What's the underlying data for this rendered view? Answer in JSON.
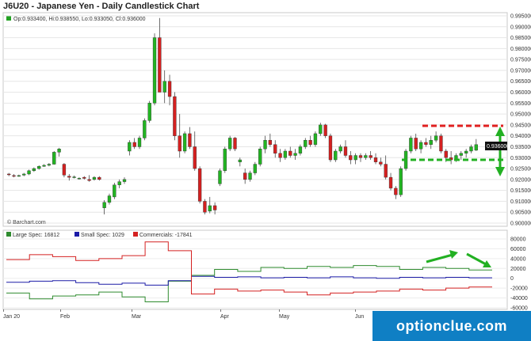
{
  "chart_title": "J6U20 - Japanese Yen - Daily Candlestick Chart",
  "ohlc_legend": "Op:0.933400, Hi:0.938550, Lo:0.933050, Cl:0.936000",
  "last_price": "0.936000",
  "watermark": "© Barchart.com",
  "cot_legend": [
    {
      "label": "Large Spec: 16812",
      "color": "#2e8b2e"
    },
    {
      "label": "Small Spec: 1029",
      "color": "#1a1aa6"
    },
    {
      "label": "Commercials: -17841",
      "color": "#d42020"
    }
  ],
  "brand": "optionclue.com",
  "chart_data": {
    "type": "candlestick",
    "title": "J6U20 - Japanese Yen - Daily Candlestick Chart",
    "price_axis": {
      "ylim": [
        0.9,
        0.995
      ],
      "ticks": [
        "0.995000",
        "0.990000",
        "0.985000",
        "0.980000",
        "0.975000",
        "0.970000",
        "0.965000",
        "0.960000",
        "0.955000",
        "0.950000",
        "0.945000",
        "0.940000",
        "0.935000",
        "0.930000",
        "0.925000",
        "0.920000",
        "0.915000",
        "0.910000",
        "0.905000",
        "0.900000"
      ]
    },
    "x_axis": {
      "month_labels": [
        "Jan 20",
        "Feb",
        "Mar",
        "Apr",
        "May",
        "Jun"
      ]
    },
    "candles": [
      [
        0.9225,
        0.923,
        0.9215,
        0.9222
      ],
      [
        0.9218,
        0.9225,
        0.921,
        0.9215
      ],
      [
        0.9215,
        0.9222,
        0.9212,
        0.9218
      ],
      [
        0.922,
        0.923,
        0.9215,
        0.9225
      ],
      [
        0.9225,
        0.9245,
        0.922,
        0.924
      ],
      [
        0.924,
        0.9255,
        0.9235,
        0.925
      ],
      [
        0.925,
        0.9265,
        0.9245,
        0.926
      ],
      [
        0.926,
        0.927,
        0.9258,
        0.9265
      ],
      [
        0.9265,
        0.9275,
        0.926,
        0.927
      ],
      [
        0.927,
        0.933,
        0.9268,
        0.9325
      ],
      [
        0.9325,
        0.9345,
        0.9305,
        0.934
      ],
      [
        0.927,
        0.9275,
        0.921,
        0.922
      ],
      [
        0.9215,
        0.9225,
        0.9195,
        0.921
      ],
      [
        0.921,
        0.9218,
        0.9205,
        0.9212
      ],
      [
        0.9205,
        0.921,
        0.92,
        0.9206
      ],
      [
        0.921,
        0.9215,
        0.92,
        0.9205
      ],
      [
        0.92,
        0.922,
        0.919,
        0.9195
      ],
      [
        0.92,
        0.9215,
        0.9195,
        0.921
      ],
      [
        0.921,
        0.9215,
        0.9195,
        0.92
      ],
      [
        0.907,
        0.9105,
        0.904,
        0.9095
      ],
      [
        0.9095,
        0.9135,
        0.9085,
        0.9125
      ],
      [
        0.912,
        0.9185,
        0.911,
        0.9175
      ],
      [
        0.9175,
        0.92,
        0.916,
        0.919
      ],
      [
        0.919,
        0.921,
        0.918,
        0.92
      ],
      [
        0.933,
        0.938,
        0.931,
        0.937
      ],
      [
        0.937,
        0.939,
        0.934,
        0.935
      ],
      [
        0.935,
        0.94,
        0.934,
        0.939
      ],
      [
        0.939,
        0.948,
        0.938,
        0.947
      ],
      [
        0.947,
        0.956,
        0.946,
        0.955
      ],
      [
        0.955,
        0.987,
        0.954,
        0.985
      ],
      [
        0.985,
        0.994,
        0.962,
        0.96
      ],
      [
        0.96,
        0.97,
        0.955,
        0.965
      ],
      [
        0.965,
        0.968,
        0.954,
        0.958
      ],
      [
        0.958,
        0.96,
        0.938,
        0.94
      ],
      [
        0.94,
        0.95,
        0.93,
        0.933
      ],
      [
        0.933,
        0.942,
        0.932,
        0.941
      ],
      [
        0.941,
        0.944,
        0.934,
        0.935
      ],
      [
        0.935,
        0.942,
        0.924,
        0.925
      ],
      [
        0.925,
        0.926,
        0.909,
        0.91
      ],
      [
        0.91,
        0.911,
        0.904,
        0.905
      ],
      [
        0.9055,
        0.912,
        0.9045,
        0.908
      ],
      [
        0.908,
        0.9095,
        0.904,
        0.906
      ],
      [
        0.918,
        0.925,
        0.917,
        0.924
      ],
      [
        0.924,
        0.935,
        0.923,
        0.934
      ],
      [
        0.934,
        0.94,
        0.933,
        0.939
      ],
      [
        0.939,
        0.9395,
        0.933,
        0.934
      ],
      [
        0.928,
        0.93,
        0.926,
        0.929
      ],
      [
        0.923,
        0.925,
        0.918,
        0.92
      ],
      [
        0.92,
        0.924,
        0.919,
        0.923
      ],
      [
        0.923,
        0.928,
        0.922,
        0.927
      ],
      [
        0.927,
        0.935,
        0.926,
        0.934
      ],
      [
        0.934,
        0.94,
        0.932,
        0.938
      ],
      [
        0.938,
        0.941,
        0.935,
        0.936
      ],
      [
        0.936,
        0.938,
        0.93,
        0.932
      ],
      [
        0.932,
        0.934,
        0.928,
        0.93
      ],
      [
        0.93,
        0.934,
        0.929,
        0.933
      ],
      [
        0.933,
        0.935,
        0.93,
        0.931
      ],
      [
        0.931,
        0.934,
        0.929,
        0.932
      ],
      [
        0.932,
        0.936,
        0.931,
        0.935
      ],
      [
        0.935,
        0.939,
        0.934,
        0.938
      ],
      [
        0.938,
        0.94,
        0.935,
        0.936
      ],
      [
        0.936,
        0.942,
        0.935,
        0.941
      ],
      [
        0.941,
        0.946,
        0.94,
        0.945
      ],
      [
        0.945,
        0.9455,
        0.939,
        0.94
      ],
      [
        0.94,
        0.941,
        0.928,
        0.929
      ],
      [
        0.929,
        0.934,
        0.928,
        0.933
      ],
      [
        0.933,
        0.936,
        0.932,
        0.935
      ],
      [
        0.935,
        0.938,
        0.93,
        0.931
      ],
      [
        0.931,
        0.933,
        0.927,
        0.929
      ],
      [
        0.929,
        0.932,
        0.927,
        0.931
      ],
      [
        0.931,
        0.932,
        0.928,
        0.93
      ],
      [
        0.93,
        0.932,
        0.929,
        0.931
      ],
      [
        0.931,
        0.933,
        0.929,
        0.93
      ],
      [
        0.93,
        0.932,
        0.927,
        0.928
      ],
      [
        0.928,
        0.93,
        0.926,
        0.927
      ],
      [
        0.927,
        0.931,
        0.92,
        0.921
      ],
      [
        0.921,
        0.923,
        0.915,
        0.916
      ],
      [
        0.916,
        0.917,
        0.911,
        0.913
      ],
      [
        0.913,
        0.926,
        0.912,
        0.925
      ],
      [
        0.925,
        0.934,
        0.924,
        0.933
      ],
      [
        0.933,
        0.94,
        0.932,
        0.939
      ],
      [
        0.939,
        0.941,
        0.933,
        0.934
      ],
      [
        0.934,
        0.938,
        0.932,
        0.937
      ],
      [
        0.937,
        0.939,
        0.935,
        0.936
      ],
      [
        0.936,
        0.94,
        0.934,
        0.938
      ],
      [
        0.938,
        0.942,
        0.937,
        0.94
      ],
      [
        0.94,
        0.941,
        0.932,
        0.933
      ],
      [
        0.933,
        0.934,
        0.928,
        0.93
      ],
      [
        0.93,
        0.933,
        0.927,
        0.929
      ],
      [
        0.929,
        0.932,
        0.928,
        0.931
      ],
      [
        0.931,
        0.933,
        0.929,
        0.932
      ],
      [
        0.932,
        0.934,
        0.93,
        0.933
      ],
      [
        0.933,
        0.936,
        0.932,
        0.935
      ],
      [
        0.9334,
        0.93855,
        0.93305,
        0.936
      ]
    ],
    "cot_axis": {
      "ylim": [
        -60000,
        80000
      ],
      "ticks": [
        "80000",
        "60000",
        "40000",
        "20000",
        "0",
        "-20000",
        "-40000",
        "-60000"
      ]
    },
    "cot_series": [
      {
        "name": "Large Spec",
        "color": "#2e8b2e",
        "values": [
          -30000,
          -42000,
          -36000,
          -34000,
          -28000,
          -38000,
          -48000,
          -6000,
          6000,
          18000,
          14000,
          22000,
          20000,
          24000,
          22000,
          26000,
          24000,
          18000,
          22000,
          20000,
          16812
        ]
      },
      {
        "name": "Small Spec",
        "color": "#1a1aa6",
        "values": [
          -8000,
          -6000,
          -5000,
          -9000,
          -12000,
          -10000,
          -14000,
          -5000,
          4000,
          2000,
          3000,
          1000,
          2000,
          1000,
          3000,
          1000,
          0,
          2000,
          1000,
          2000,
          1029
        ]
      },
      {
        "name": "Commercials",
        "color": "#d42020",
        "values": [
          38000,
          48000,
          44000,
          36000,
          40000,
          46000,
          74000,
          56000,
          -32000,
          -22000,
          -26000,
          -24000,
          -28000,
          -34000,
          -30000,
          -28000,
          -26000,
          -22000,
          -24000,
          -20000,
          -17841
        ]
      }
    ]
  }
}
